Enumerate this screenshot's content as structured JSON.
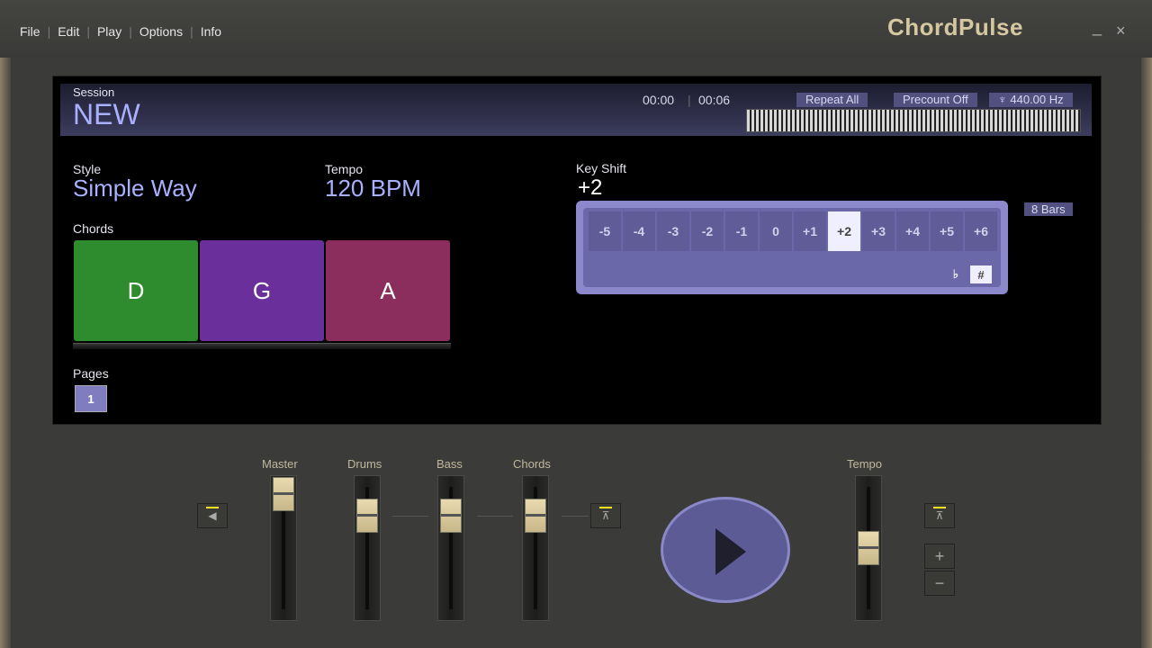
{
  "menu": {
    "items": [
      "File",
      "Edit",
      "Play",
      "Options",
      "Info"
    ]
  },
  "brand": "ChordPulse",
  "window": {
    "minimize": "_",
    "close": "×"
  },
  "session": {
    "label": "Session",
    "name": "NEW",
    "time_elapsed": "00:00",
    "time_total": "00:06",
    "repeat": "Repeat All",
    "precount": "Precount Off",
    "tuning": "♆ 440.00 Hz"
  },
  "style": {
    "label": "Style",
    "value": "Simple Way"
  },
  "tempo": {
    "label": "Tempo",
    "value": "120 BPM"
  },
  "chords": {
    "label": "Chords",
    "items": [
      {
        "name": "D",
        "color": "#2e8b2e"
      },
      {
        "name": "G",
        "color": "#6a2f9a"
      },
      {
        "name": "A",
        "color": "#8b2e5e"
      }
    ]
  },
  "keyshift": {
    "label": "Key Shift",
    "value": "+2",
    "options": [
      "-5",
      "-4",
      "-3",
      "-2",
      "-1",
      "0",
      "+1",
      "+2",
      "+3",
      "+4",
      "+5",
      "+6"
    ],
    "selected": "+2",
    "flat": "♭",
    "sharp": "#",
    "bars": "8 Bars"
  },
  "pages": {
    "label": "Pages",
    "items": [
      "1"
    ]
  },
  "mixer": {
    "master": "Master",
    "drums": "Drums",
    "bass": "Bass",
    "chords": "Chords",
    "tempo": "Tempo",
    "tempo_plus": "+",
    "tempo_minus": "−"
  }
}
